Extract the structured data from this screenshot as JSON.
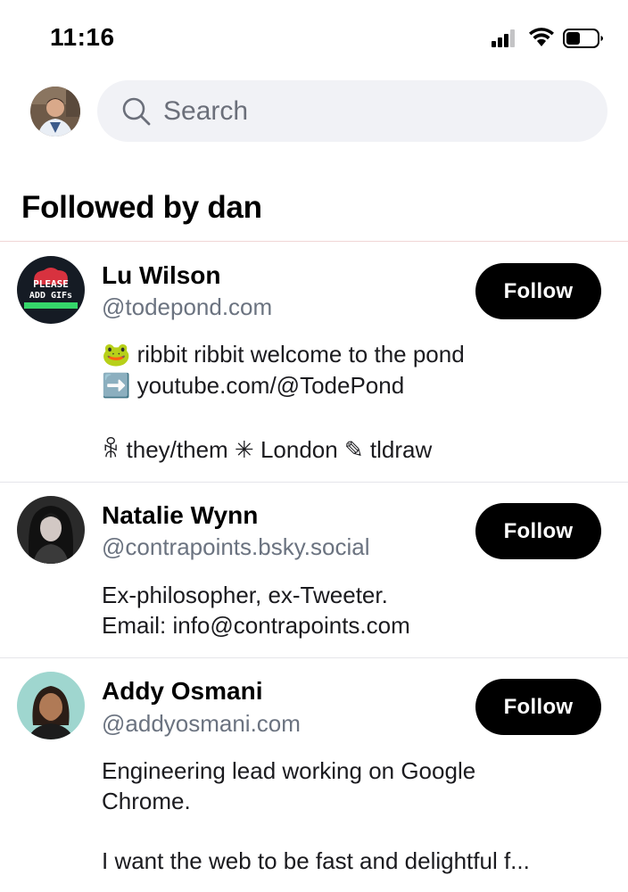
{
  "status_bar": {
    "time": "11:16",
    "icons": [
      "cellular-signal-icon",
      "wifi-icon",
      "battery-icon"
    ]
  },
  "header": {
    "search_placeholder": "Search"
  },
  "section": {
    "title": "Followed by dan"
  },
  "colors": {
    "button_bg": "#000000",
    "button_text": "#ffffff",
    "handle_text": "#6b7380",
    "search_bg": "#f1f2f6"
  },
  "users": [
    {
      "name": "Lu Wilson",
      "handle": "@todepond.com",
      "follow_label": "Follow",
      "bio": [
        "🐸 ribbit ribbit welcome to the pond",
        "➡️ youtube.com/@TodePond",
        "",
        "ꆜ they/them ✳ London ✎ tldraw"
      ],
      "avatar_text": [
        "PLEASE",
        "ADD GIFs"
      ]
    },
    {
      "name": "Natalie Wynn",
      "handle": "@contrapoints.bsky.social",
      "follow_label": "Follow",
      "bio": [
        "Ex-philosopher, ex-Tweeter.",
        "Email: info@contrapoints.com"
      ]
    },
    {
      "name": "Addy Osmani",
      "handle": "@addyosmani.com",
      "follow_label": "Follow",
      "bio": [
        "Engineering lead working on Google",
        "Chrome.",
        "",
        "I want the web to be fast and delightful f..."
      ]
    }
  ]
}
